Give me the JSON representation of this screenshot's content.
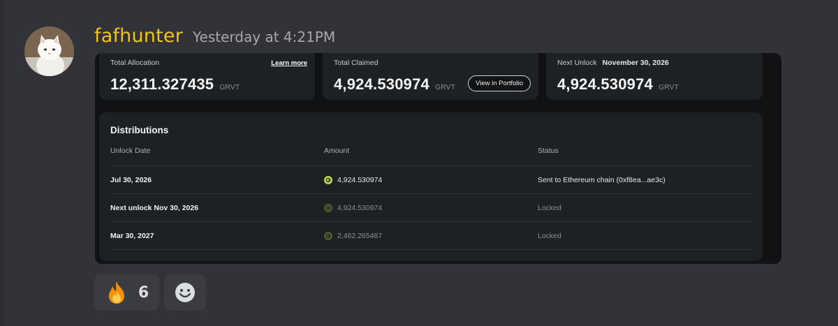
{
  "message": {
    "username": "fafhunter",
    "timestamp": "Yesterday at 4:21PM",
    "avatar_icon": "white-cat-avatar"
  },
  "stats": {
    "total_allocation": {
      "label": "Total Allocation",
      "value": "12,311.327435",
      "unit": "GRVT",
      "link": "Learn more"
    },
    "total_claimed": {
      "label": "Total Claimed",
      "value": "4,924.530974",
      "unit": "GRVT",
      "button": "View in Portfolio"
    },
    "next_unlock": {
      "label": "Next Unlock",
      "date": "November 30, 2026",
      "value": "4,924.530974",
      "unit": "GRVT"
    }
  },
  "distributions": {
    "title": "Distributions",
    "columns": [
      "Unlock Date",
      "Amount",
      "Status"
    ],
    "rows": [
      {
        "date": "Jul 30, 2026",
        "amount": "4,924.530974",
        "status": "Sent to Ethereum chain (0xf8ea...ae3c)"
      },
      {
        "date": "Next unlock Nov 30, 2026",
        "amount": "4,924.530974",
        "status": "Locked"
      },
      {
        "date": "Mar 30, 2027",
        "amount": "2,462.265487",
        "status": "Locked"
      }
    ]
  },
  "reactions": {
    "fire": {
      "emoji": "fire-emoji",
      "count": "6"
    },
    "add_reaction_icon": "smiley-add-reaction-icon"
  },
  "colors": {
    "username": "#f0c419",
    "background": "#313338",
    "embed": "#101213",
    "card": "#1e2124",
    "token_active": "#b8d94a"
  }
}
